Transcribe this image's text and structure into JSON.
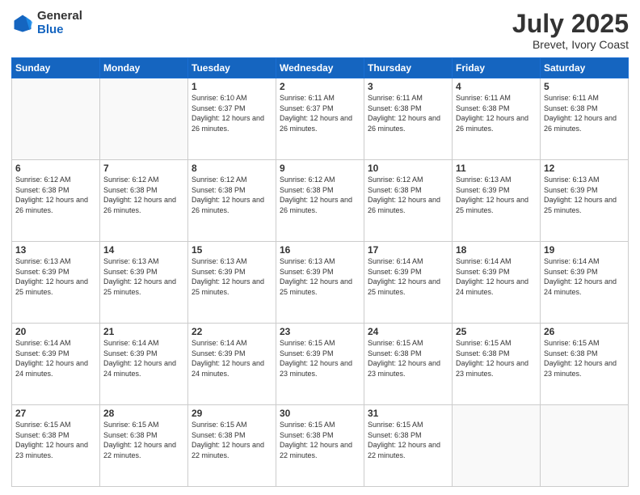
{
  "header": {
    "logo_general": "General",
    "logo_blue": "Blue",
    "title": "July 2025",
    "subtitle": "Brevet, Ivory Coast"
  },
  "days_of_week": [
    "Sunday",
    "Monday",
    "Tuesday",
    "Wednesday",
    "Thursday",
    "Friday",
    "Saturday"
  ],
  "weeks": [
    [
      {
        "day": "",
        "info": ""
      },
      {
        "day": "",
        "info": ""
      },
      {
        "day": "1",
        "info": "Sunrise: 6:10 AM\nSunset: 6:37 PM\nDaylight: 12 hours and 26 minutes."
      },
      {
        "day": "2",
        "info": "Sunrise: 6:11 AM\nSunset: 6:37 PM\nDaylight: 12 hours and 26 minutes."
      },
      {
        "day": "3",
        "info": "Sunrise: 6:11 AM\nSunset: 6:38 PM\nDaylight: 12 hours and 26 minutes."
      },
      {
        "day": "4",
        "info": "Sunrise: 6:11 AM\nSunset: 6:38 PM\nDaylight: 12 hours and 26 minutes."
      },
      {
        "day": "5",
        "info": "Sunrise: 6:11 AM\nSunset: 6:38 PM\nDaylight: 12 hours and 26 minutes."
      }
    ],
    [
      {
        "day": "6",
        "info": "Sunrise: 6:12 AM\nSunset: 6:38 PM\nDaylight: 12 hours and 26 minutes."
      },
      {
        "day": "7",
        "info": "Sunrise: 6:12 AM\nSunset: 6:38 PM\nDaylight: 12 hours and 26 minutes."
      },
      {
        "day": "8",
        "info": "Sunrise: 6:12 AM\nSunset: 6:38 PM\nDaylight: 12 hours and 26 minutes."
      },
      {
        "day": "9",
        "info": "Sunrise: 6:12 AM\nSunset: 6:38 PM\nDaylight: 12 hours and 26 minutes."
      },
      {
        "day": "10",
        "info": "Sunrise: 6:12 AM\nSunset: 6:38 PM\nDaylight: 12 hours and 26 minutes."
      },
      {
        "day": "11",
        "info": "Sunrise: 6:13 AM\nSunset: 6:39 PM\nDaylight: 12 hours and 25 minutes."
      },
      {
        "day": "12",
        "info": "Sunrise: 6:13 AM\nSunset: 6:39 PM\nDaylight: 12 hours and 25 minutes."
      }
    ],
    [
      {
        "day": "13",
        "info": "Sunrise: 6:13 AM\nSunset: 6:39 PM\nDaylight: 12 hours and 25 minutes."
      },
      {
        "day": "14",
        "info": "Sunrise: 6:13 AM\nSunset: 6:39 PM\nDaylight: 12 hours and 25 minutes."
      },
      {
        "day": "15",
        "info": "Sunrise: 6:13 AM\nSunset: 6:39 PM\nDaylight: 12 hours and 25 minutes."
      },
      {
        "day": "16",
        "info": "Sunrise: 6:13 AM\nSunset: 6:39 PM\nDaylight: 12 hours and 25 minutes."
      },
      {
        "day": "17",
        "info": "Sunrise: 6:14 AM\nSunset: 6:39 PM\nDaylight: 12 hours and 25 minutes."
      },
      {
        "day": "18",
        "info": "Sunrise: 6:14 AM\nSunset: 6:39 PM\nDaylight: 12 hours and 24 minutes."
      },
      {
        "day": "19",
        "info": "Sunrise: 6:14 AM\nSunset: 6:39 PM\nDaylight: 12 hours and 24 minutes."
      }
    ],
    [
      {
        "day": "20",
        "info": "Sunrise: 6:14 AM\nSunset: 6:39 PM\nDaylight: 12 hours and 24 minutes."
      },
      {
        "day": "21",
        "info": "Sunrise: 6:14 AM\nSunset: 6:39 PM\nDaylight: 12 hours and 24 minutes."
      },
      {
        "day": "22",
        "info": "Sunrise: 6:14 AM\nSunset: 6:39 PM\nDaylight: 12 hours and 24 minutes."
      },
      {
        "day": "23",
        "info": "Sunrise: 6:15 AM\nSunset: 6:39 PM\nDaylight: 12 hours and 23 minutes."
      },
      {
        "day": "24",
        "info": "Sunrise: 6:15 AM\nSunset: 6:38 PM\nDaylight: 12 hours and 23 minutes."
      },
      {
        "day": "25",
        "info": "Sunrise: 6:15 AM\nSunset: 6:38 PM\nDaylight: 12 hours and 23 minutes."
      },
      {
        "day": "26",
        "info": "Sunrise: 6:15 AM\nSunset: 6:38 PM\nDaylight: 12 hours and 23 minutes."
      }
    ],
    [
      {
        "day": "27",
        "info": "Sunrise: 6:15 AM\nSunset: 6:38 PM\nDaylight: 12 hours and 23 minutes."
      },
      {
        "day": "28",
        "info": "Sunrise: 6:15 AM\nSunset: 6:38 PM\nDaylight: 12 hours and 22 minutes."
      },
      {
        "day": "29",
        "info": "Sunrise: 6:15 AM\nSunset: 6:38 PM\nDaylight: 12 hours and 22 minutes."
      },
      {
        "day": "30",
        "info": "Sunrise: 6:15 AM\nSunset: 6:38 PM\nDaylight: 12 hours and 22 minutes."
      },
      {
        "day": "31",
        "info": "Sunrise: 6:15 AM\nSunset: 6:38 PM\nDaylight: 12 hours and 22 minutes."
      },
      {
        "day": "",
        "info": ""
      },
      {
        "day": "",
        "info": ""
      }
    ]
  ]
}
